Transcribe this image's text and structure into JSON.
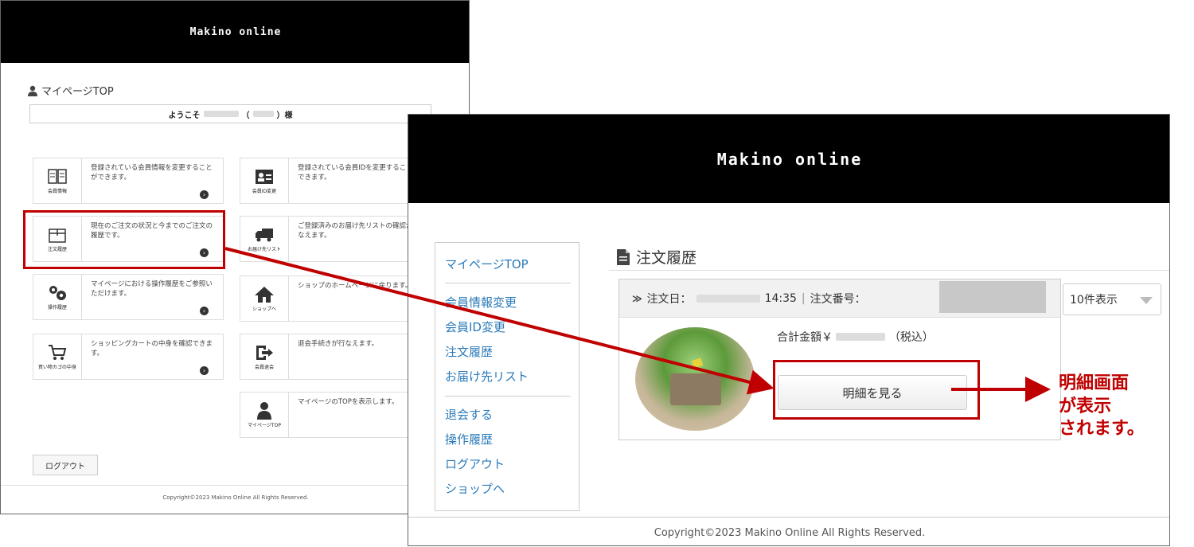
{
  "left_screen": {
    "brand": "Makino online",
    "page_title": "マイページTOP",
    "welcome_prefix": "ようこそ",
    "welcome_mid": "（",
    "welcome_suffix": "）様",
    "cards": [
      {
        "icon": "book-icon",
        "label": "会員情報",
        "desc": "登録されている会員情報を変更することができます。"
      },
      {
        "icon": "id-card-icon",
        "label": "会員ID変更",
        "desc": "登録されている会員IDを変更することができます。"
      },
      {
        "icon": "box-icon",
        "label": "注文履歴",
        "desc": "現在のご注文の状況と今までのご注文の履歴です。"
      },
      {
        "icon": "truck-icon",
        "label": "お届け先リスト",
        "desc": "ご登録済みのお届け先リストの確認が行なえます。"
      },
      {
        "icon": "gears-icon",
        "label": "操作履歴",
        "desc": "マイページにおける操作履歴をご参照いただけます。"
      },
      {
        "icon": "home-icon",
        "label": "ショップへ",
        "desc": "ショップのホームページに戻ります。"
      },
      {
        "icon": "cart-icon",
        "label": "買い物カゴの中身",
        "desc": "ショッピングカートの中身を確認できます。"
      },
      {
        "icon": "exit-icon",
        "label": "会員退会",
        "desc": "退会手続きが行なえます。"
      },
      {
        "icon": "user-icon",
        "label": "マイページTOP",
        "desc": "マイページのTOPを表示します。"
      }
    ],
    "logout_label": "ログアウト",
    "copyright": "Copyright©2023 Makino Online All Rights Reserved."
  },
  "right_screen": {
    "brand": "Makino online",
    "sidebar": {
      "items": [
        "マイページTOP",
        "会員情報変更",
        "会員ID変更",
        "注文履歴",
        "お届け先リスト",
        "退会する",
        "操作履歴",
        "ログアウト",
        "ショップへ"
      ]
    },
    "title": "注文履歴",
    "order": {
      "date_label": "注文日：",
      "time": "14:35",
      "separator": "|",
      "order_no_label": "注文番号：",
      "total_label": "合計金額￥",
      "total_suffix": "（税込）",
      "detail_button": "明細を見る"
    },
    "per_page": "10件表示",
    "copyright": "Copyright©2023 Makino Online All Rights Reserved."
  },
  "annotation": {
    "line1": "明細画面",
    "line2": "が表示",
    "line3": "されます。",
    "color": "#c00000"
  }
}
